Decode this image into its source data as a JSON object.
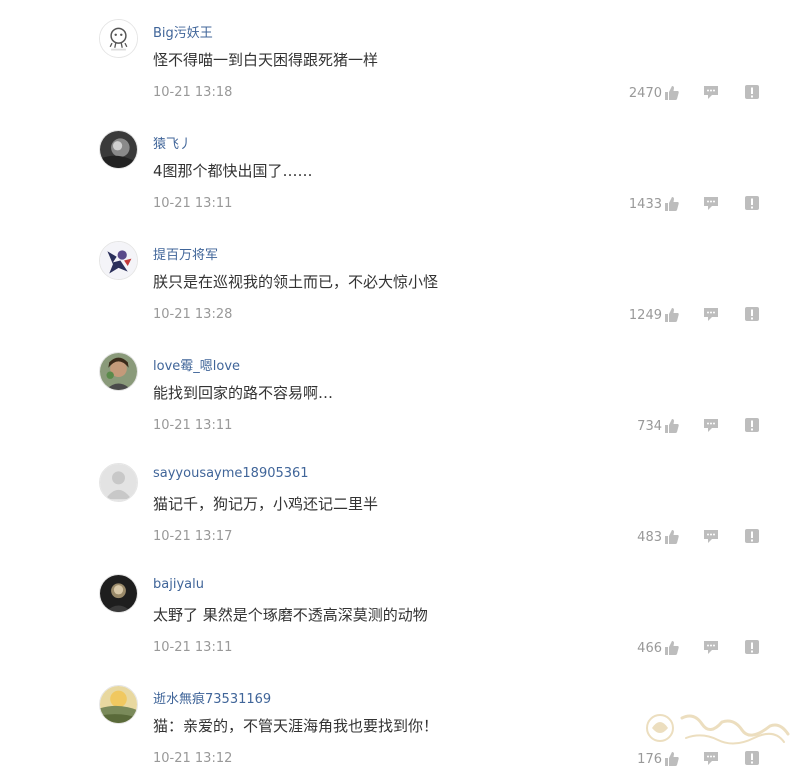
{
  "comments": [
    {
      "username": "Big污妖王",
      "content": "怪不得喵一到白天困得跟死猪一样",
      "time": "10-21 13:18",
      "likes": "2470",
      "avatar": "robot-avatar"
    },
    {
      "username": "猿飞丿",
      "content": "4图那个都快出国了……",
      "time": "10-21 13:11",
      "likes": "1433",
      "avatar": "dark-photo-avatar"
    },
    {
      "username": "提百万将军",
      "content": "朕只是在巡视我的领土而已，不必大惊小怪",
      "time": "10-21 13:28",
      "likes": "1249",
      "avatar": "anime-avatar"
    },
    {
      "username": "love霉_嗯love",
      "content": "能找到回家的路不容易啊…",
      "time": "10-21 13:11",
      "likes": "734",
      "avatar": "portrait-avatar"
    },
    {
      "username": "sayyousayme18905361",
      "content": "猫记千，狗记万，小鸡还记二里半",
      "time": "10-21 13:17",
      "likes": "483",
      "avatar": "default-avatar"
    },
    {
      "username": "bajiyalu",
      "content": "太野了 果然是个琢磨不透高深莫测的动物",
      "time": "10-21 13:11",
      "likes": "466",
      "avatar": "dark-portrait-avatar"
    },
    {
      "username": "逝水無痕73531169",
      "content": "猫：亲爱的，不管天涯海角我也要找到你！",
      "time": "10-21 13:12",
      "likes": "176",
      "avatar": "sunset-avatar"
    }
  ],
  "icons": {
    "like": "thumbs-up-icon",
    "reply": "speech-bubble-icon",
    "report": "exclamation-icon"
  },
  "colors": {
    "username": "#406599",
    "text": "#333333",
    "meta": "#999999",
    "icon": "#bdbdbd"
  }
}
